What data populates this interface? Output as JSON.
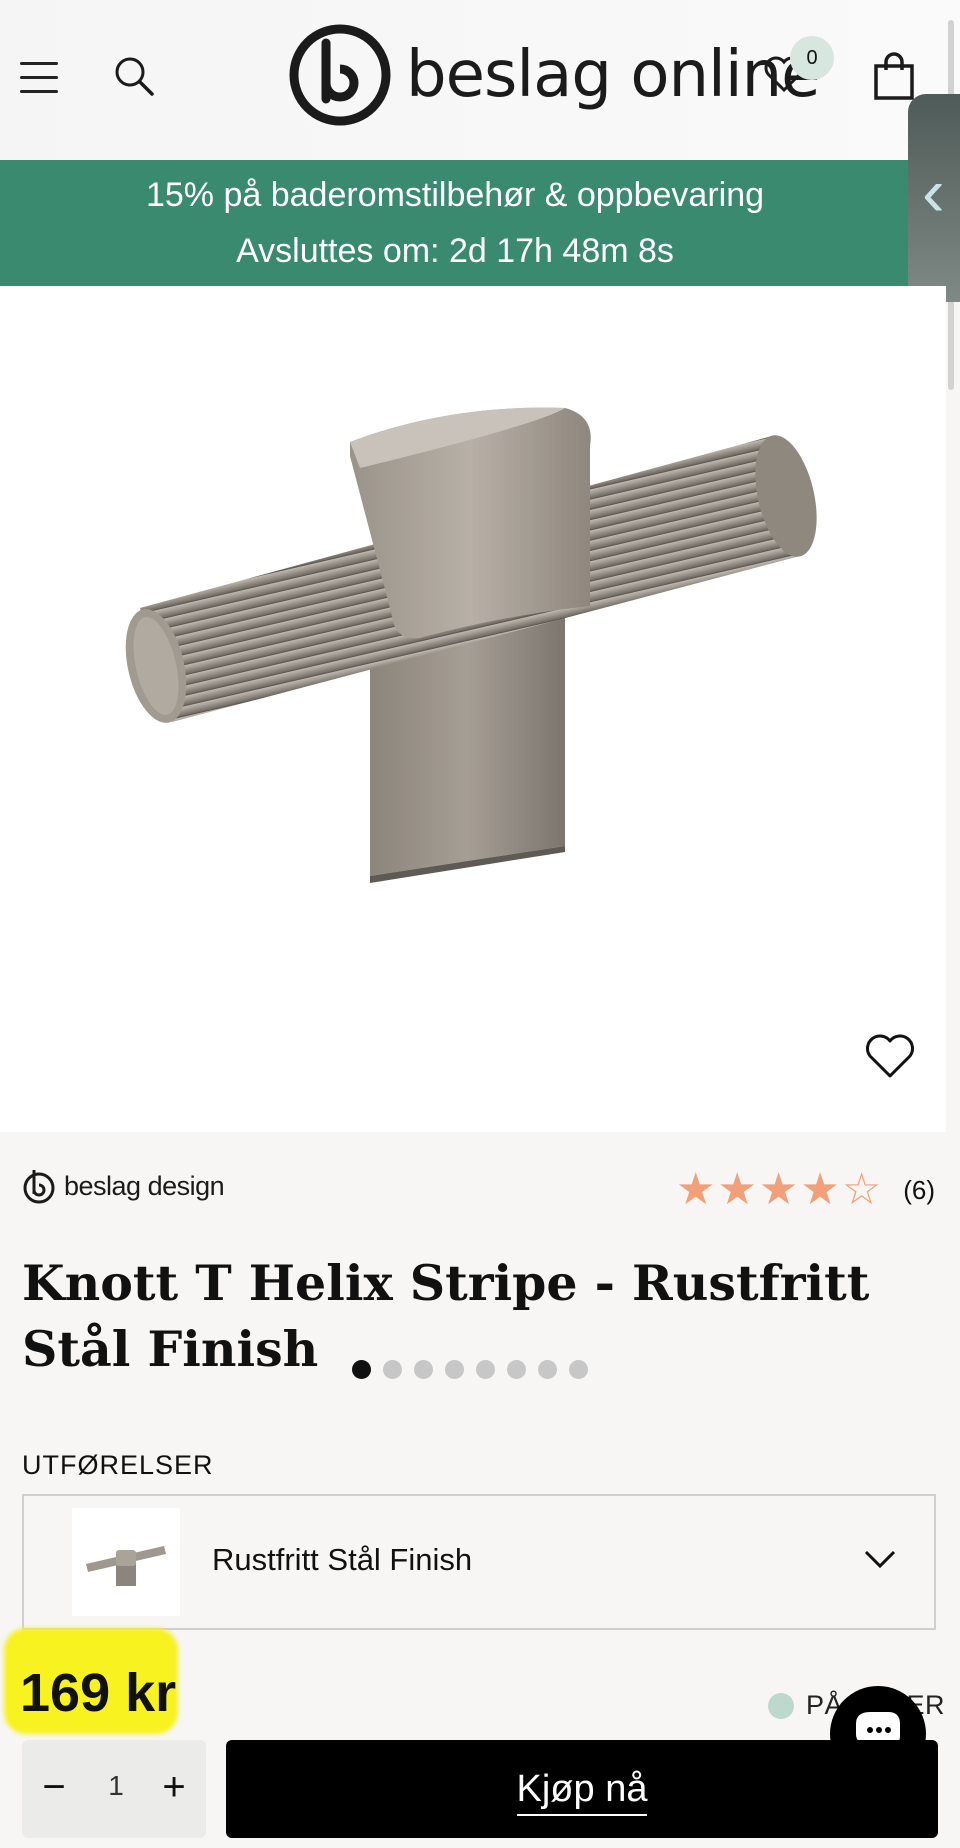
{
  "header": {
    "logo_text": "beslag online",
    "wishlist_count": "0"
  },
  "promo": {
    "line1": "15% på baderomstilbehør & oppbevaring",
    "line2": "Avsluttes om: 2d 17h 48m 8s",
    "color": "#3a8a70"
  },
  "gallery": {
    "image_count": 8,
    "active_index": 0
  },
  "brand": {
    "name": "beslag design"
  },
  "rating": {
    "value": 4.5,
    "max": 5,
    "count_label": "(6)",
    "star_color": "#f2a07a"
  },
  "product": {
    "title": "Knott T Helix Stripe - Rustfritt Stål Finish",
    "price": "169 kr",
    "stock_label": "PÅ LAGER"
  },
  "variant": {
    "label": "UTFØRELSER",
    "selected": "Rustfritt Stål Finish"
  },
  "purchase": {
    "qty_minus": "−",
    "qty_value": "1",
    "qty_plus": "+",
    "buy_label": "Kjøp nå"
  },
  "icons": {
    "menu": "menu-icon",
    "search": "search-icon",
    "wishlist": "heart-icon",
    "cart": "shopping-bag-icon",
    "side_tab": "chevron-left-icon",
    "favorite": "heart-icon",
    "chat": "chat-icon",
    "dropdown": "chevron-down-icon"
  }
}
